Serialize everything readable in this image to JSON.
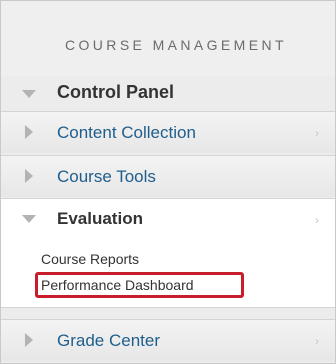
{
  "section_title": "COURSE MANAGEMENT",
  "control_panel": {
    "label": "Control Panel",
    "icon": "triangle-down-icon"
  },
  "menu": {
    "content_collection": "Content Collection",
    "course_tools": "Course Tools",
    "evaluation": {
      "label": "Evaluation",
      "items": [
        "Course Reports",
        "Performance Dashboard"
      ]
    },
    "grade_center": "Grade Center"
  },
  "chevron_glyph": "›",
  "colors": {
    "link": "#1f5e8c",
    "highlight_border": "#c81e2b",
    "panel_background": "#ececec"
  }
}
